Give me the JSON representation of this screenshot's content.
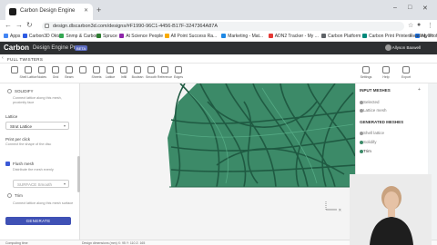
{
  "browser": {
    "tab_title": "Carbon Design Engine",
    "url": "design.dlscarbon3d.com/designs/#F1990-96C1-4456-B17F-3247364A87A",
    "bookmarks": [
      {
        "label": "Apps",
        "color": "#4285f4"
      },
      {
        "label": "Carbon3D Okta",
        "color": "#2d5be3"
      },
      {
        "label": "Snmp & Carbon",
        "color": "#34a853"
      },
      {
        "label": "Spruce",
        "color": "#2e7d32"
      },
      {
        "label": "At Science People",
        "color": "#8e24aa"
      },
      {
        "label": "All Point Success Ra...",
        "color": "#f9ab00"
      },
      {
        "label": "Marketing - Mat...",
        "color": "#1e88e5"
      },
      {
        "label": "ADN2 Tracker - My ...",
        "color": "#e53935"
      },
      {
        "label": "Carbon Platform",
        "color": "#5f6368"
      },
      {
        "label": "Carbon Print Printers",
        "color": "#00897b"
      },
      {
        "label": "My Profile - Zoom",
        "color": "#1a73e8"
      }
    ],
    "reading_list": "Reading list"
  },
  "app": {
    "logo": "Carbon",
    "product": "Design Engine Pro",
    "beta": "BETA",
    "user": "Allyson Baxwell",
    "file_name": "FULL TWISTERS",
    "tools": [
      "",
      "Shell Lattice",
      "Nodes",
      "Grid",
      "Beam",
      "",
      "Sheets",
      "Lattice",
      "Infill",
      "Boolean",
      "Smooth",
      "Reference",
      "Edges"
    ],
    "right_tools": [
      "Settings",
      "Help",
      "Export"
    ]
  },
  "left_panel": {
    "section": "SOLIDIFY",
    "hint1": "Connect lattice along this mesh, proximity face",
    "lattice_label": "Lattice",
    "lattice_value": "Strut Lattice",
    "print_label": "Print per click",
    "hint2": "Connect the shape of the disc",
    "check_label": "Flush mesh",
    "hint3": "Distribute the mesh evenly",
    "select2_value": "SURFACE  Smooth",
    "trim_label": "Trim",
    "hint4": "Connect lattice along this mesh surface",
    "generate": "GENERATE"
  },
  "right_panel": {
    "input_title": "INPUT MESHES",
    "inputs": [
      "Selected",
      "Lattice mesh"
    ],
    "generated_title": "GENERATED MESHES",
    "generated": [
      "Shell lattice",
      "Solidify",
      "Trim"
    ]
  },
  "status": {
    "left": "Computing time",
    "center": "Design dimensions (mm)  X: 95  Y: 110  Z: 165"
  },
  "colors": {
    "lattice": "#3c8a68",
    "lattice_dark": "#1f5a42",
    "accent": "#3f51b5"
  }
}
